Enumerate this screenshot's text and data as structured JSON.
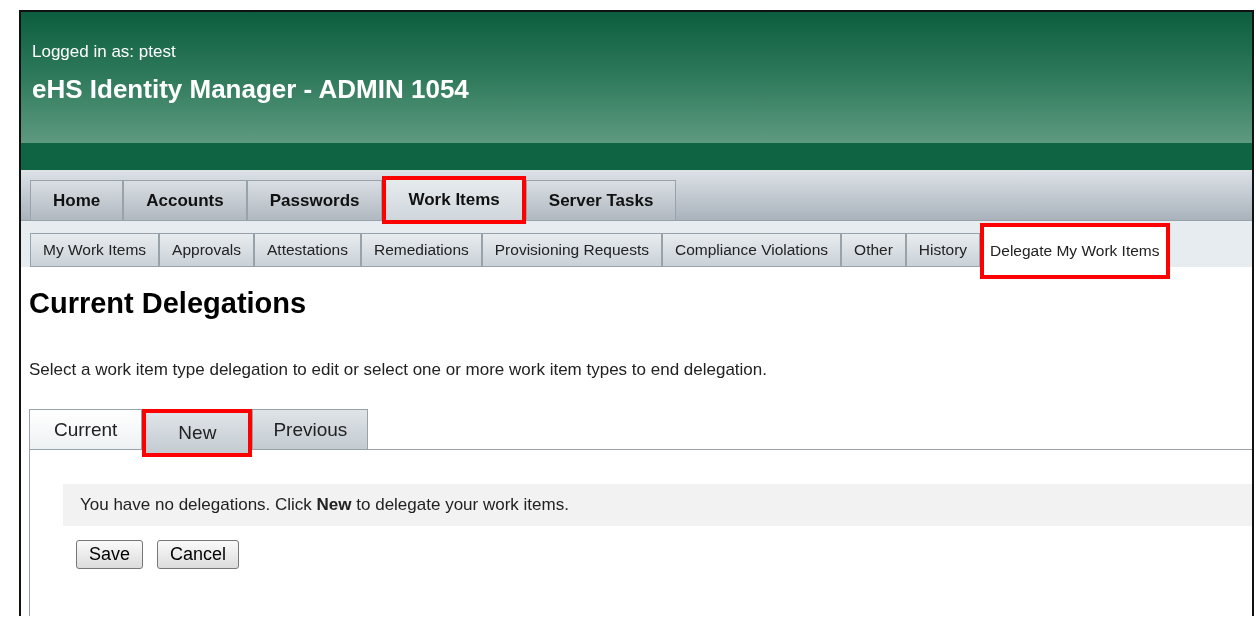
{
  "header": {
    "user_line": "Logged in as: ptest",
    "title": "eHS Identity Manager - ADMIN 1054"
  },
  "main_tabs": [
    {
      "label": "Home",
      "selected": false,
      "highlighted": false
    },
    {
      "label": "Accounts",
      "selected": false,
      "highlighted": false
    },
    {
      "label": "Passwords",
      "selected": false,
      "highlighted": false
    },
    {
      "label": "Work Items",
      "selected": true,
      "highlighted": true
    },
    {
      "label": "Server Tasks",
      "selected": false,
      "highlighted": false
    }
  ],
  "sub_tabs": [
    {
      "label": "My Work Items",
      "selected": false,
      "highlighted": false
    },
    {
      "label": "Approvals",
      "selected": false,
      "highlighted": false
    },
    {
      "label": "Attestations",
      "selected": false,
      "highlighted": false
    },
    {
      "label": "Remediations",
      "selected": false,
      "highlighted": false
    },
    {
      "label": "Provisioning Requests",
      "selected": false,
      "highlighted": false
    },
    {
      "label": "Compliance Violations",
      "selected": false,
      "highlighted": false
    },
    {
      "label": "Other",
      "selected": false,
      "highlighted": false
    },
    {
      "label": "History",
      "selected": false,
      "highlighted": false
    },
    {
      "label": "Delegate My Work Items",
      "selected": true,
      "highlighted": true
    }
  ],
  "page_title": "Current Delegations",
  "instructions": "Select a work item type delegation to edit or select one or more work item types to end delegation.",
  "delegation_tabs": [
    {
      "label": "Current",
      "selected": true,
      "highlighted": false
    },
    {
      "label": "New",
      "selected": false,
      "highlighted": true
    },
    {
      "label": "Previous",
      "selected": false,
      "highlighted": false
    }
  ],
  "message": "You have no delegations. Click **New** to delegate your work items.",
  "buttons": [
    "Save",
    "Cancel"
  ]
}
